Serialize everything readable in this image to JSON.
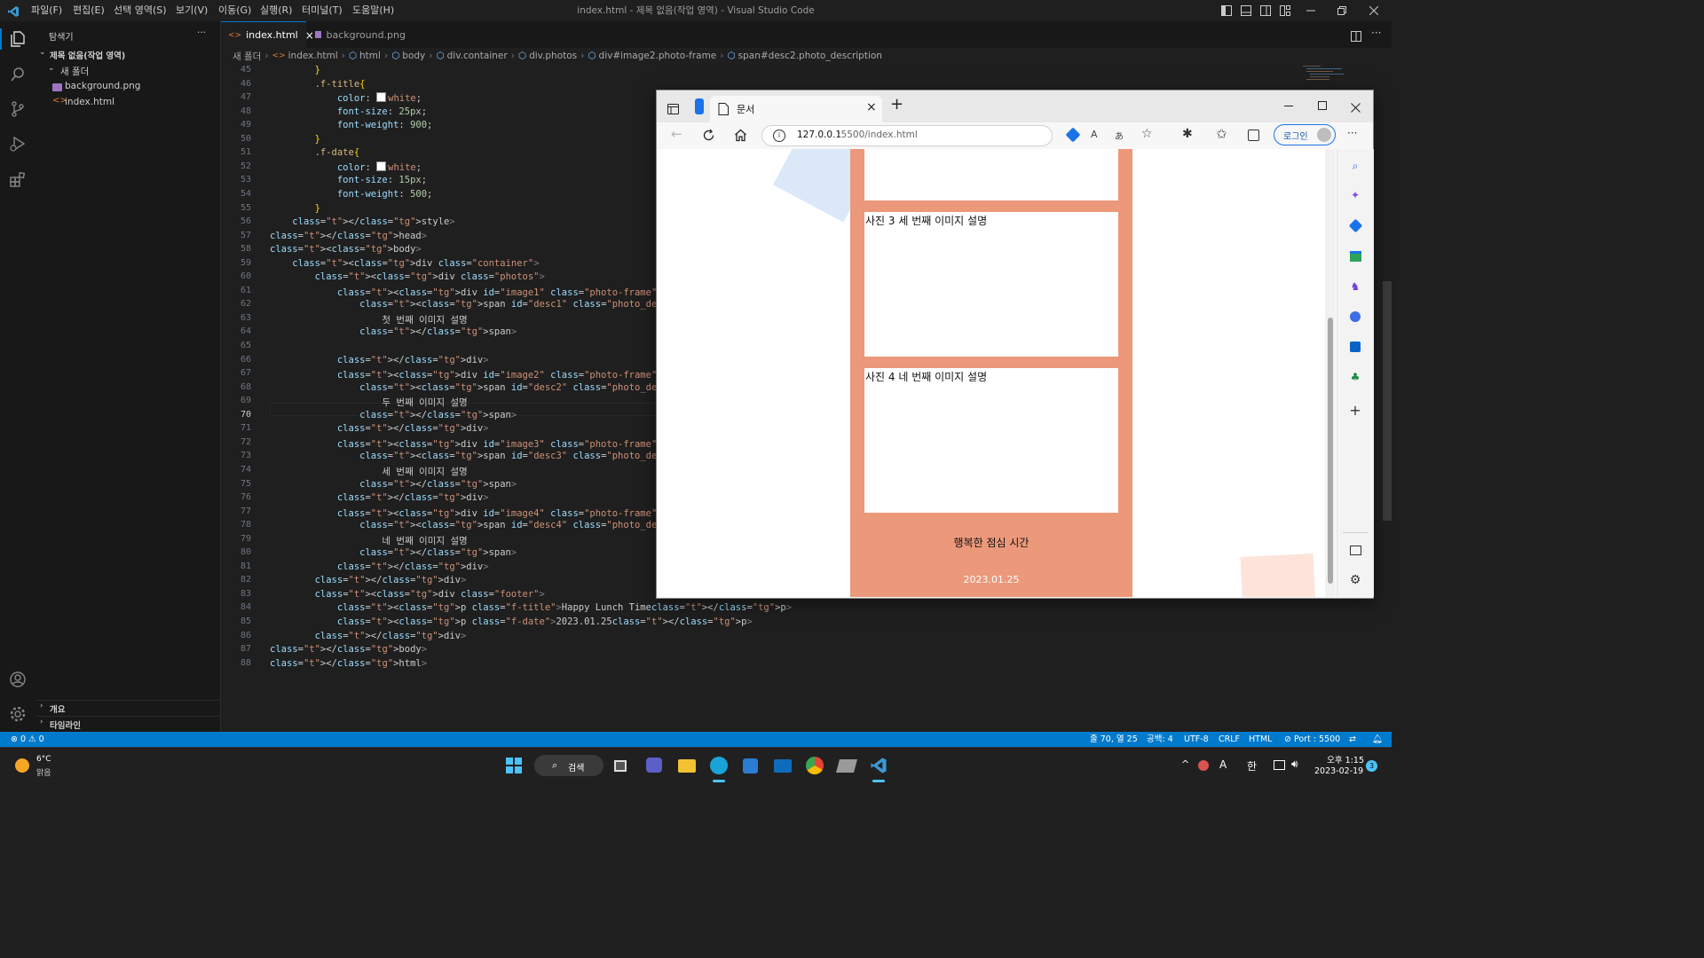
{
  "window": {
    "title": "index.html - 제목 없음(작업 영역) - Visual Studio Code",
    "menu": [
      "파일(F)",
      "편집(E)",
      "선택 영역(S)",
      "보기(V)",
      "이동(G)",
      "실행(R)",
      "터미널(T)",
      "도움말(H)"
    ]
  },
  "sidebar": {
    "header": "탐색기",
    "more": "···",
    "workspace": "제목 없음(작업 영역)",
    "folder": "새 폴더",
    "files": [
      "background.png",
      "index.html"
    ],
    "outline": "개요",
    "timeline": "타임라인"
  },
  "tabs": [
    {
      "label": "index.html",
      "close": "×"
    },
    {
      "label": "background.png"
    }
  ],
  "breadcrumb": [
    "새 폴더",
    "index.html",
    "html",
    "body",
    "div.container",
    "div.photos",
    "div#image2.photo-frame",
    "span#desc2.photo_description"
  ],
  "editor": {
    "active_line": "70",
    "lines": [
      {
        "n": "45",
        "t": "        }"
      },
      {
        "n": "46",
        "t": "        .f-title{"
      },
      {
        "n": "47",
        "t": "            color: white;"
      },
      {
        "n": "48",
        "t": "            font-size: 25px;"
      },
      {
        "n": "49",
        "t": "            font-weight: 900;"
      },
      {
        "n": "50",
        "t": "        }"
      },
      {
        "n": "51",
        "t": "        .f-date{"
      },
      {
        "n": "52",
        "t": "            color: white;"
      },
      {
        "n": "53",
        "t": "            font-size: 15px;"
      },
      {
        "n": "54",
        "t": "            font-weight: 500;"
      },
      {
        "n": "55",
        "t": "        }"
      },
      {
        "n": "56",
        "t": "    </style>"
      },
      {
        "n": "57",
        "t": "</head>"
      },
      {
        "n": "58",
        "t": "<body>"
      },
      {
        "n": "59",
        "t": "    <div class=\"container\">"
      },
      {
        "n": "60",
        "t": "        <div class=\"photos\">"
      },
      {
        "n": "61",
        "t": "            <div id=\"image1\" class=\"photo-frame\">사진 1"
      },
      {
        "n": "62",
        "t": "                <span id=\"desc1\" class=\"photo_description\">"
      },
      {
        "n": "63",
        "t": "                    첫 번째 이미지 설명"
      },
      {
        "n": "64",
        "t": "                </span>"
      },
      {
        "n": "65",
        "t": ""
      },
      {
        "n": "66",
        "t": "            </div>"
      },
      {
        "n": "67",
        "t": "            <div id=\"image2\" class=\"photo-frame\">사진 2"
      },
      {
        "n": "68",
        "t": "                <span id=\"desc2\" class=\"photo_description\">"
      },
      {
        "n": "69",
        "t": "                    두 번째 이미지 설명"
      },
      {
        "n": "70",
        "t": "                </span>"
      },
      {
        "n": "71",
        "t": "            </div>"
      },
      {
        "n": "72",
        "t": "            <div id=\"image3\" class=\"photo-frame\">사진 3"
      },
      {
        "n": "73",
        "t": "                <span id=\"desc3\" class=\"photo_description\">"
      },
      {
        "n": "74",
        "t": "                    세 번째 이미지 설명"
      },
      {
        "n": "75",
        "t": "                </span>"
      },
      {
        "n": "76",
        "t": "            </div>"
      },
      {
        "n": "77",
        "t": "            <div id=\"image4\" class=\"photo-frame\">사진 4"
      },
      {
        "n": "78",
        "t": "                <span id=\"desc4\" class=\"photo_description\">"
      },
      {
        "n": "79",
        "t": "                    네 번째 이미지 설명"
      },
      {
        "n": "80",
        "t": "                </span>"
      },
      {
        "n": "81",
        "t": "            </div>"
      },
      {
        "n": "82",
        "t": "        </div>"
      },
      {
        "n": "83",
        "t": "        <div class=\"footer\">"
      },
      {
        "n": "84",
        "t": "            <p class=\"f-title\">Happy Lunch Time</p>"
      },
      {
        "n": "85",
        "t": "            <p class=\"f-date\">2023.01.25</p>"
      },
      {
        "n": "86",
        "t": "        </div>"
      },
      {
        "n": "87",
        "t": "</body>"
      },
      {
        "n": "88",
        "t": "</html>"
      }
    ]
  },
  "browser": {
    "tab_title": "문서",
    "tab_close": "×",
    "new_tab": "+",
    "url_host": "127.0.0.1",
    "url_path": ":5500/index.html",
    "login": "로그인",
    "more": "···",
    "page": {
      "photo3": "사진 3 세 번째 이미지 설명",
      "photo4": "사진 4 네 번째 이미지 설명",
      "footer_title": "행복한 점심 시간",
      "footer_date": "2023.01.25",
      "accent_color": "#eb987b"
    }
  },
  "statusbar": {
    "problems": "⊗ 0 ⚠ 0",
    "position": "줄 70, 열 25",
    "spaces": "공백: 4",
    "encoding": "UTF-8",
    "eol": "CRLF",
    "language": "HTML",
    "port": "⊘ Port : 5500"
  },
  "taskbar": {
    "weather_temp": "6°C",
    "weather_desc": "맑음",
    "search": "검색",
    "ime_a": "A",
    "ime_han": "한",
    "time": "오후 1:15",
    "date": "2023-02-19",
    "notifications": "3"
  }
}
